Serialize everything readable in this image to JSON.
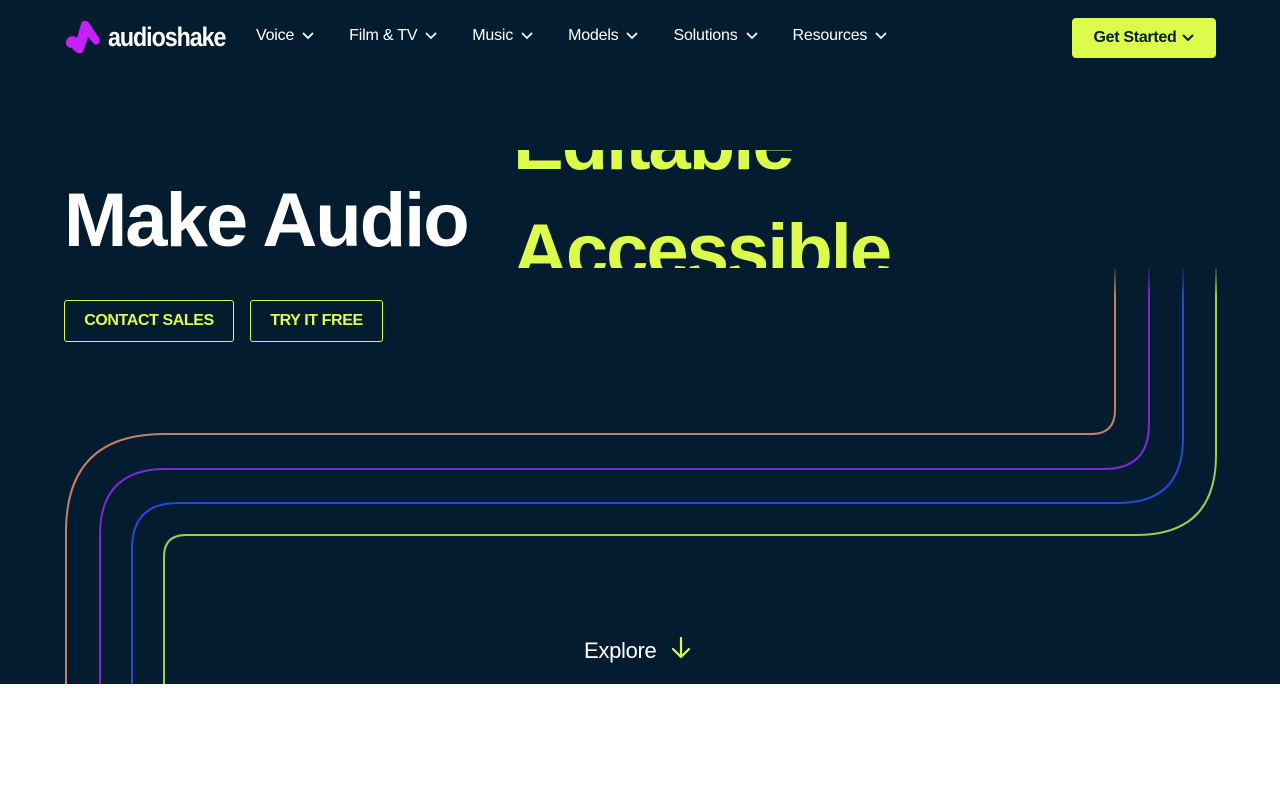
{
  "brand": {
    "name": "audioshake"
  },
  "nav": {
    "items": [
      {
        "label": "Voice"
      },
      {
        "label": "Film & TV"
      },
      {
        "label": "Music"
      },
      {
        "label": "Models"
      },
      {
        "label": "Solutions"
      },
      {
        "label": "Resources"
      }
    ],
    "cta_label": "Get Started"
  },
  "hero": {
    "headline": "Make Audio",
    "rotating_words": {
      "previous": "Editable",
      "current": "Accessible"
    },
    "contact_label": "CONTACT SALES",
    "try_label": "TRY IT FREE",
    "explore_label": "Explore"
  },
  "colors": {
    "background": "#031c2f",
    "accent": "#dcfb4b",
    "logo": "#c81fff",
    "line_orange": "#c9805f",
    "line_purple": "#7a2bd6",
    "line_blue": "#2448d8",
    "line_green": "#a6c94a"
  },
  "icons": {
    "logo_mark": "audioshake-logo-icon",
    "dropdown": "chevron-down-icon",
    "explore": "arrow-down-icon"
  }
}
